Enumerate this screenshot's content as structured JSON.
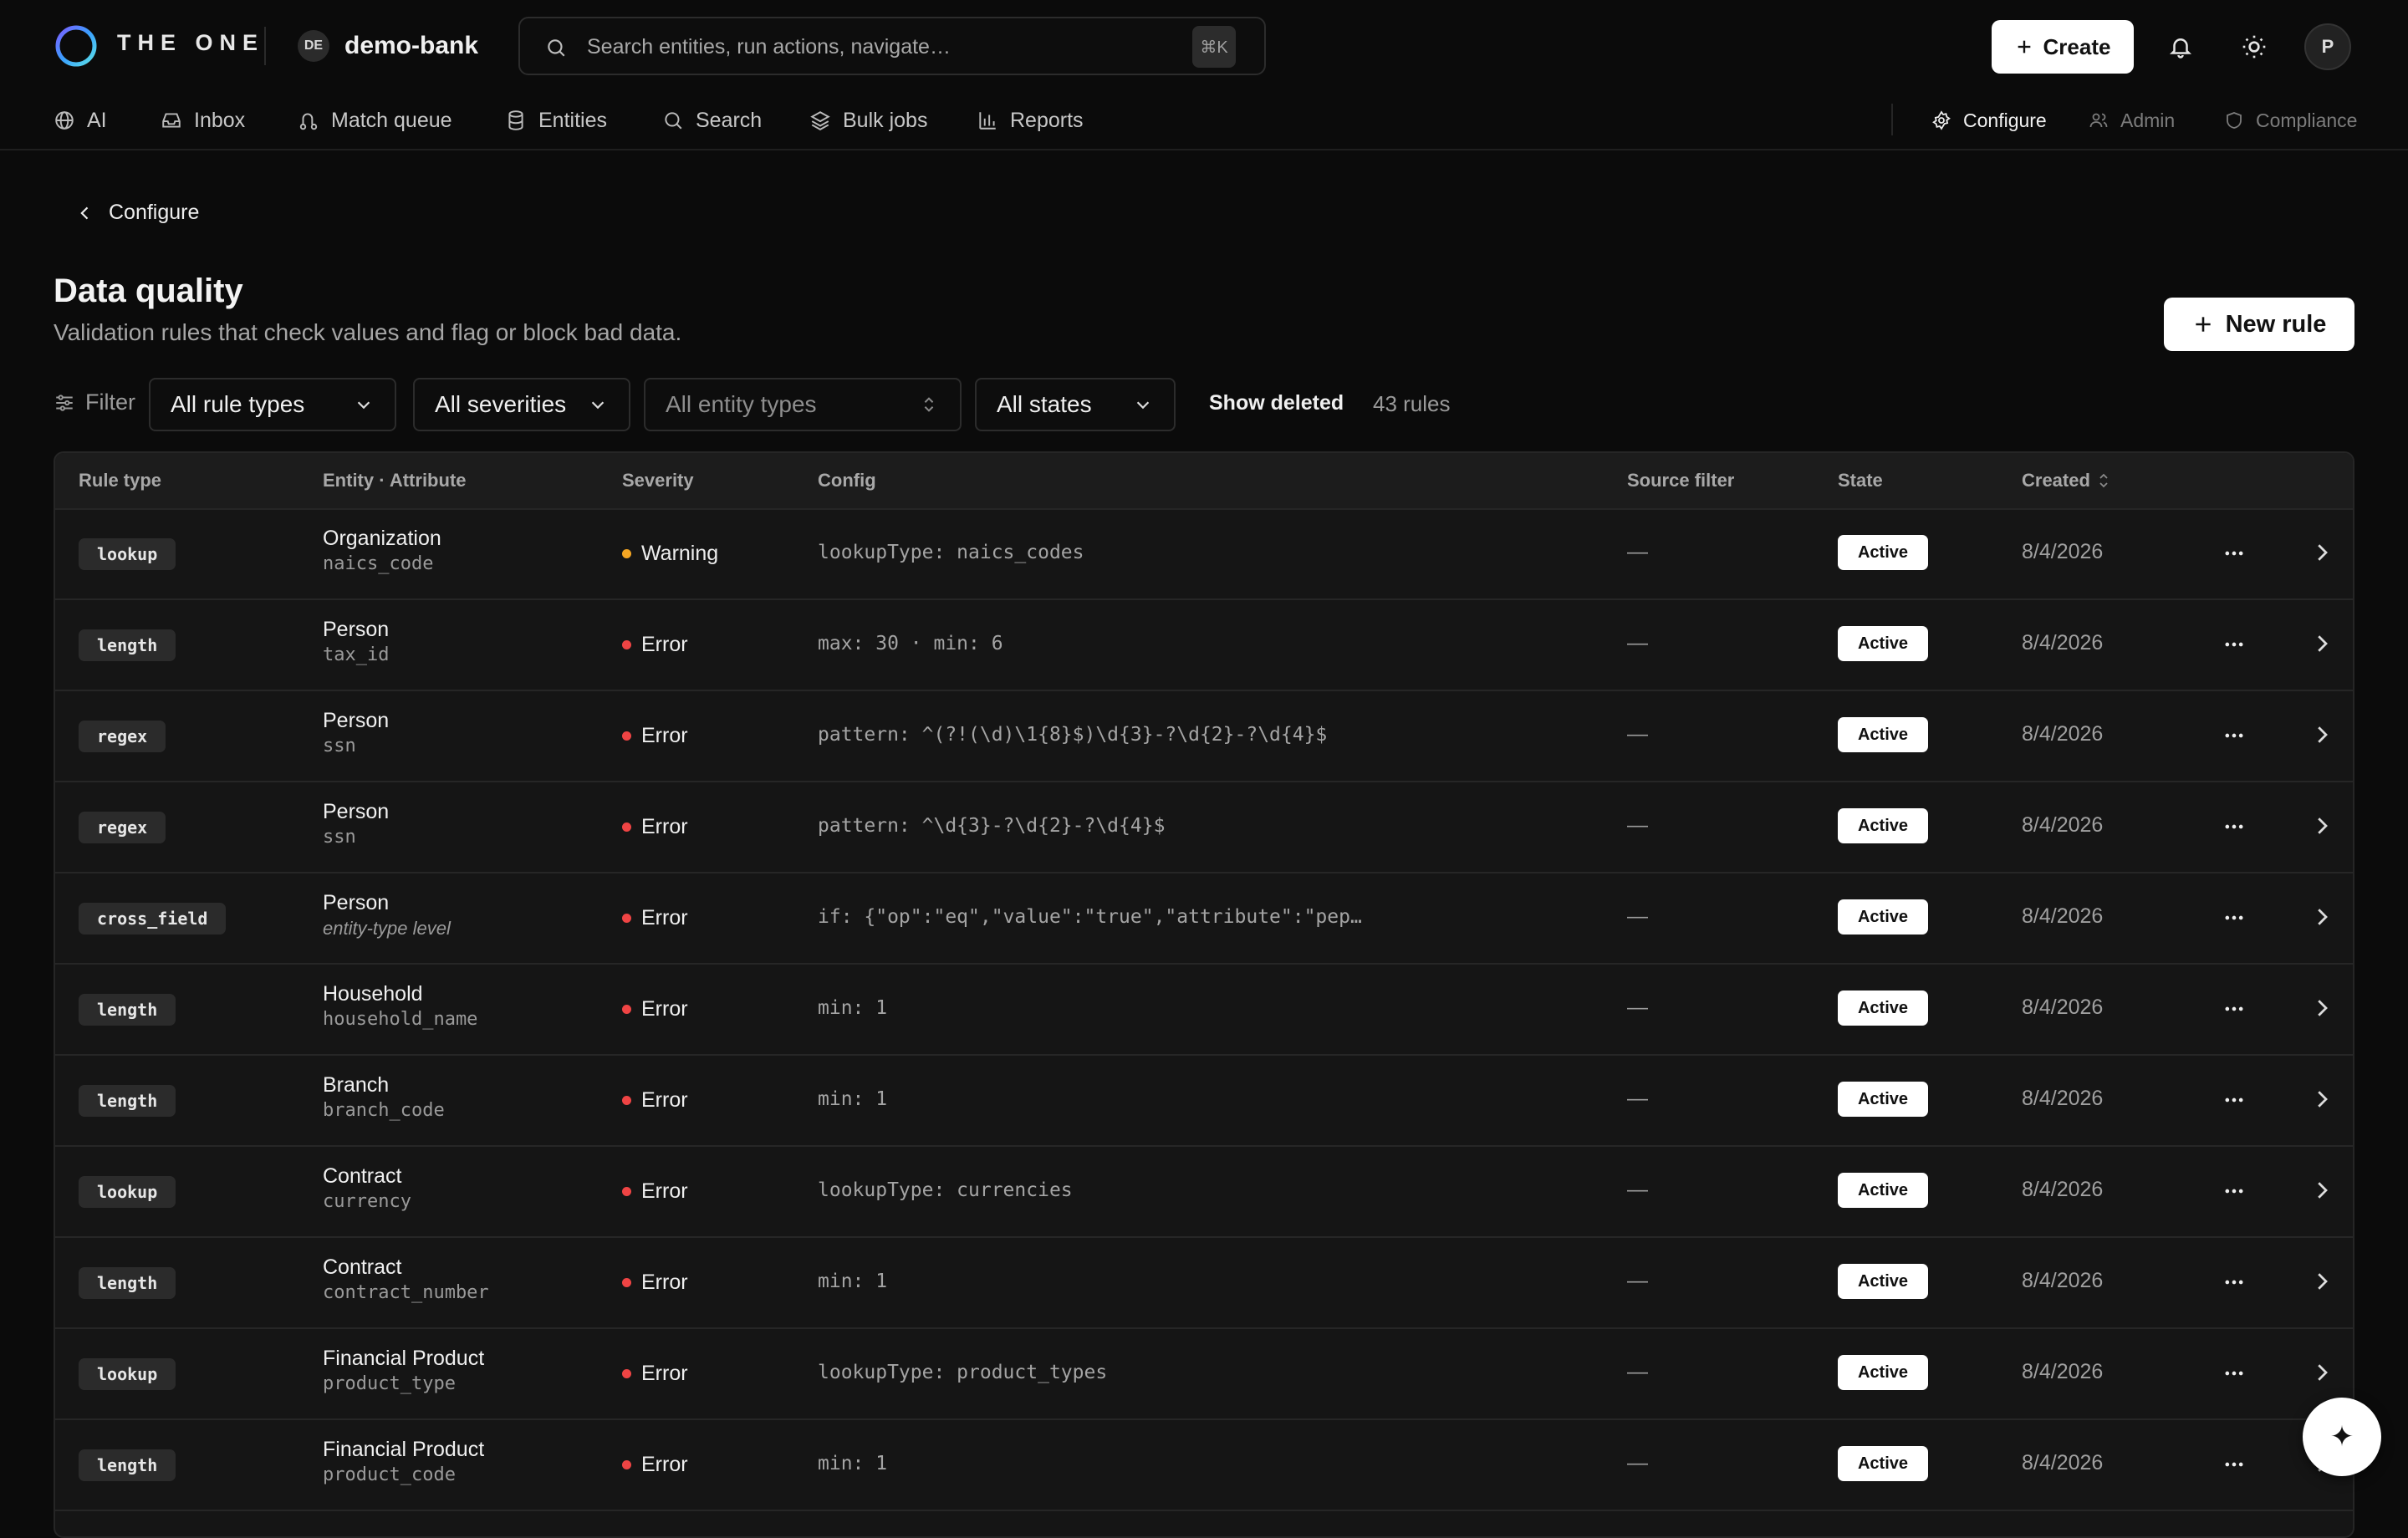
{
  "brand": {
    "name": "THE ONE"
  },
  "tenant": {
    "initials": "DE",
    "name": "demo-bank"
  },
  "search": {
    "placeholder": "Search entities, run actions, navigate…",
    "shortcut": "⌘K"
  },
  "header_actions": {
    "create_label": "Create",
    "avatar_initial": "P"
  },
  "nav": {
    "items": [
      {
        "label": "AI",
        "icon": "globe-icon"
      },
      {
        "label": "Inbox",
        "icon": "inbox-icon"
      },
      {
        "label": "Match queue",
        "icon": "route-icon"
      },
      {
        "label": "Entities",
        "icon": "database-icon"
      },
      {
        "label": "Search",
        "icon": "search-icon"
      },
      {
        "label": "Bulk jobs",
        "icon": "layers-icon"
      },
      {
        "label": "Reports",
        "icon": "bar-chart-icon"
      }
    ],
    "right": [
      {
        "label": "Configure",
        "icon": "gear-icon",
        "active": true
      },
      {
        "label": "Admin",
        "icon": "users-icon",
        "active": false
      },
      {
        "label": "Compliance",
        "icon": "shield-icon",
        "active": false
      }
    ]
  },
  "breadcrumb": {
    "back_label": "Configure"
  },
  "page": {
    "title": "Data quality",
    "subtitle": "Validation rules that check values and flag or block bad data.",
    "new_rule_label": "New rule"
  },
  "filters": {
    "label": "Filter",
    "rule_type": "All rule types",
    "severity": "All severities",
    "entity_type": "All entity types",
    "state": "All states",
    "show_deleted_label": "Show deleted",
    "count_label": "43 rules"
  },
  "table": {
    "columns": {
      "rule_type": "Rule type",
      "entity_attr": "Entity · Attribute",
      "severity": "Severity",
      "config": "Config",
      "source_filter": "Source filter",
      "state": "State",
      "created": "Created"
    },
    "rows": [
      {
        "rule_type": "lookup",
        "entity": "Organization",
        "attribute": "naics_code",
        "attr_italic": false,
        "severity": "Warning",
        "severity_color": "#f5a623",
        "config": "lookupType: naics_codes",
        "source_filter": "—",
        "state": "Active",
        "created": "8/4/2026"
      },
      {
        "rule_type": "length",
        "entity": "Person",
        "attribute": "tax_id",
        "attr_italic": false,
        "severity": "Error",
        "severity_color": "#ef4444",
        "config": "max: 30 · min: 6",
        "source_filter": "—",
        "state": "Active",
        "created": "8/4/2026"
      },
      {
        "rule_type": "regex",
        "entity": "Person",
        "attribute": "ssn",
        "attr_italic": false,
        "severity": "Error",
        "severity_color": "#ef4444",
        "config": "pattern: ^(?!(\\d)\\1{8}$)\\d{3}-?\\d{2}-?\\d{4}$",
        "source_filter": "—",
        "state": "Active",
        "created": "8/4/2026"
      },
      {
        "rule_type": "regex",
        "entity": "Person",
        "attribute": "ssn",
        "attr_italic": false,
        "severity": "Error",
        "severity_color": "#ef4444",
        "config": "pattern: ^\\d{3}-?\\d{2}-?\\d{4}$",
        "source_filter": "—",
        "state": "Active",
        "created": "8/4/2026"
      },
      {
        "rule_type": "cross_field",
        "entity": "Person",
        "attribute": "entity-type level",
        "attr_italic": true,
        "severity": "Error",
        "severity_color": "#ef4444",
        "config": "if: {\"op\":\"eq\",\"value\":\"true\",\"attribute\":\"pep…",
        "source_filter": "—",
        "state": "Active",
        "created": "8/4/2026"
      },
      {
        "rule_type": "length",
        "entity": "Household",
        "attribute": "household_name",
        "attr_italic": false,
        "severity": "Error",
        "severity_color": "#ef4444",
        "config": "min: 1",
        "source_filter": "—",
        "state": "Active",
        "created": "8/4/2026"
      },
      {
        "rule_type": "length",
        "entity": "Branch",
        "attribute": "branch_code",
        "attr_italic": false,
        "severity": "Error",
        "severity_color": "#ef4444",
        "config": "min: 1",
        "source_filter": "—",
        "state": "Active",
        "created": "8/4/2026"
      },
      {
        "rule_type": "lookup",
        "entity": "Contract",
        "attribute": "currency",
        "attr_italic": false,
        "severity": "Error",
        "severity_color": "#ef4444",
        "config": "lookupType: currencies",
        "source_filter": "—",
        "state": "Active",
        "created": "8/4/2026"
      },
      {
        "rule_type": "length",
        "entity": "Contract",
        "attribute": "contract_number",
        "attr_italic": false,
        "severity": "Error",
        "severity_color": "#ef4444",
        "config": "min: 1",
        "source_filter": "—",
        "state": "Active",
        "created": "8/4/2026"
      },
      {
        "rule_type": "lookup",
        "entity": "Financial Product",
        "attribute": "product_type",
        "attr_italic": false,
        "severity": "Error",
        "severity_color": "#ef4444",
        "config": "lookupType: product_types",
        "source_filter": "—",
        "state": "Active",
        "created": "8/4/2026"
      },
      {
        "rule_type": "length",
        "entity": "Financial Product",
        "attribute": "product_code",
        "attr_italic": false,
        "severity": "Error",
        "severity_color": "#ef4444",
        "config": "min: 1",
        "source_filter": "—",
        "state": "Active",
        "created": "8/4/2026"
      }
    ]
  },
  "fab": {
    "icon": "sparkle-icon",
    "glyph": "✦"
  }
}
